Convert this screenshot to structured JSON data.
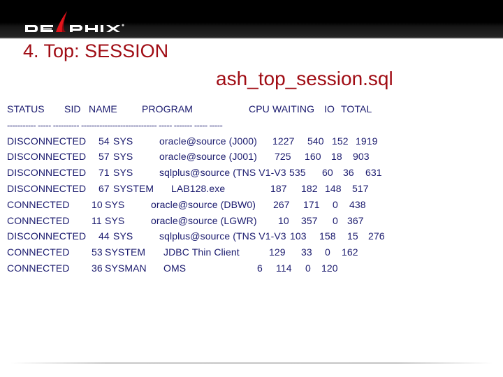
{
  "header": {
    "logo_text_left": "DE",
    "logo_text_right": "PHIX",
    "logo_mark": "®",
    "colors": {
      "background": "#000000",
      "accent": "#e3141b"
    }
  },
  "slide": {
    "title": "4. Top: SESSION",
    "subtitle": "ash_top_session.sql",
    "title_color": "#a00c14",
    "text_color": "#1a1a6e"
  },
  "table": {
    "columns": [
      "STATUS",
      "SID",
      "NAME",
      "PROGRAM",
      "CPU",
      "WAITING",
      "IO",
      "TOTAL"
    ],
    "separator": "----------- ----- ---------- ----------------------------- ----- ------- ----- -----",
    "rows": [
      {
        "status": "DISCONNECTED",
        "sid": "54",
        "name": "SYS",
        "program": "oracle@source (J000)",
        "cpu": "1227",
        "waiting": "540",
        "io": "152",
        "total": "1919"
      },
      {
        "status": "DISCONNECTED",
        "sid": "57",
        "name": "SYS",
        "program": "oracle@source (J001)",
        "cpu": "725",
        "waiting": "160",
        "io": "18",
        "total": "903"
      },
      {
        "status": "DISCONNECTED",
        "sid": "71",
        "name": "SYS",
        "program": "sqlplus@source (TNS V1-V3",
        "cpu": "535",
        "waiting": "60",
        "io": "36",
        "total": "631"
      },
      {
        "status": "DISCONNECTED",
        "sid": "67",
        "name": "SYSTEM",
        "program": "LAB128.exe",
        "cpu": "187",
        "waiting": "182",
        "io": "148",
        "total": "517"
      },
      {
        "status": "CONNECTED",
        "sid": "10",
        "name": "SYS",
        "program": "oracle@source (DBW0)",
        "cpu": "267",
        "waiting": "171",
        "io": "0",
        "total": "438"
      },
      {
        "status": "CONNECTED",
        "sid": "11",
        "name": "SYS",
        "program": "oracle@source (LGWR)",
        "cpu": "10",
        "waiting": "357",
        "io": "0",
        "total": "367"
      },
      {
        "status": "DISCONNECTED",
        "sid": "44",
        "name": "SYS",
        "program": "sqlplus@source (TNS V1-V3",
        "cpu": "103",
        "waiting": "158",
        "io": "15",
        "total": "276"
      },
      {
        "status": "CONNECTED",
        "sid": "53",
        "name": "SYSTEM",
        "program": "JDBC Thin Client",
        "cpu": "129",
        "waiting": "33",
        "io": "0",
        "total": "162"
      },
      {
        "status": "CONNECTED",
        "sid": "36",
        "name": "SYSMAN",
        "program": "OMS",
        "cpu": "6",
        "waiting": "114",
        "io": "0",
        "total": "120"
      }
    ]
  }
}
